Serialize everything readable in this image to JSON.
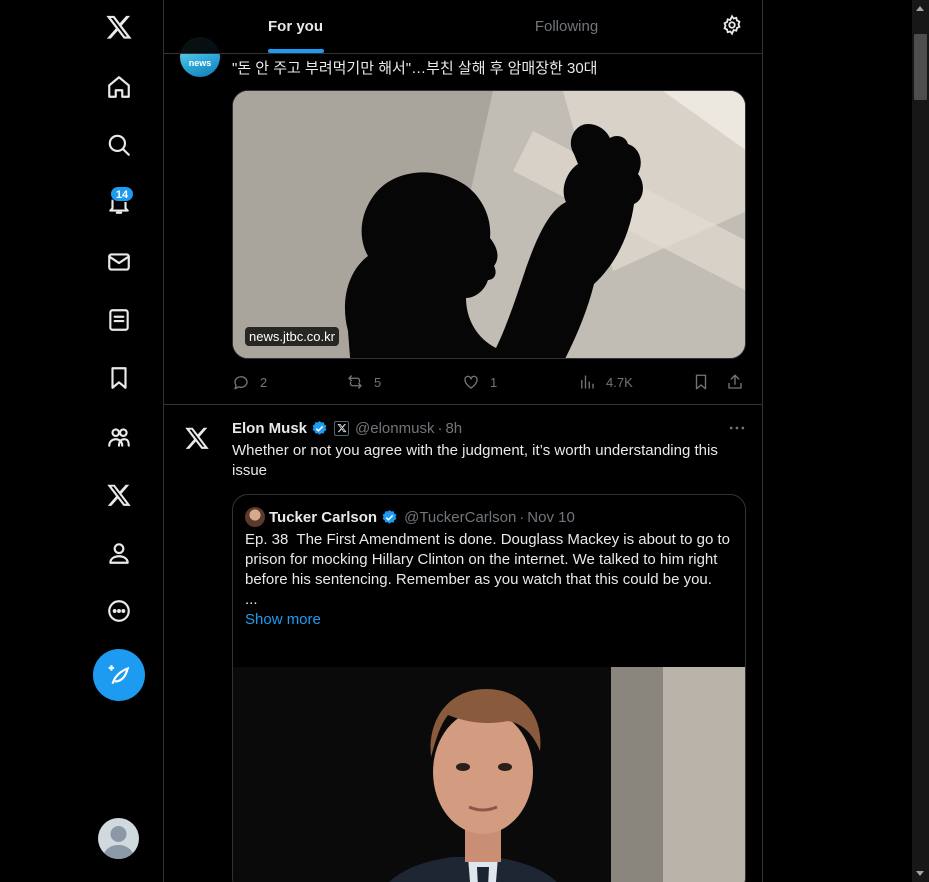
{
  "nav": {
    "items": [
      {
        "name": "x-logo-icon"
      },
      {
        "name": "home-icon"
      },
      {
        "name": "search-icon"
      },
      {
        "name": "notifications-icon"
      },
      {
        "name": "messages-icon"
      },
      {
        "name": "lists-icon"
      },
      {
        "name": "bookmarks-icon"
      },
      {
        "name": "communities-icon"
      },
      {
        "name": "premium-x-icon"
      },
      {
        "name": "profile-icon"
      },
      {
        "name": "more-icon"
      }
    ],
    "notifications_badge": "14",
    "accent": "#1d9bf0"
  },
  "header": {
    "tabs": [
      {
        "label": "For you",
        "active": true
      },
      {
        "label": "Following",
        "active": false
      }
    ]
  },
  "tweet1": {
    "avatar_text": "news",
    "text": "\"돈 안 주고 부려먹기만 해서\"…부친 살해 후 암매장한 30대",
    "media_domain": "news.jtbc.co.kr",
    "replies": "2",
    "reposts": "5",
    "likes": "1",
    "views": "4.7K"
  },
  "tweet2": {
    "author_name": "Elon Musk",
    "handle": "@elonmusk",
    "time": "8h",
    "text": "Whether or not you agree with the judgment, it’s worth understanding this issue",
    "quote": {
      "author_name": "Tucker Carlson",
      "handle": "@TuckerCarlson",
      "time": "Nov 10",
      "text": "Ep. 38  The First Amendment is done. Douglass Mackey is about to go to prison for mocking Hillary Clinton on the internet. We talked to him right before his sentencing. Remember as you watch that this could be you.",
      "ellipsis": "...",
      "show_more": "Show more"
    }
  }
}
